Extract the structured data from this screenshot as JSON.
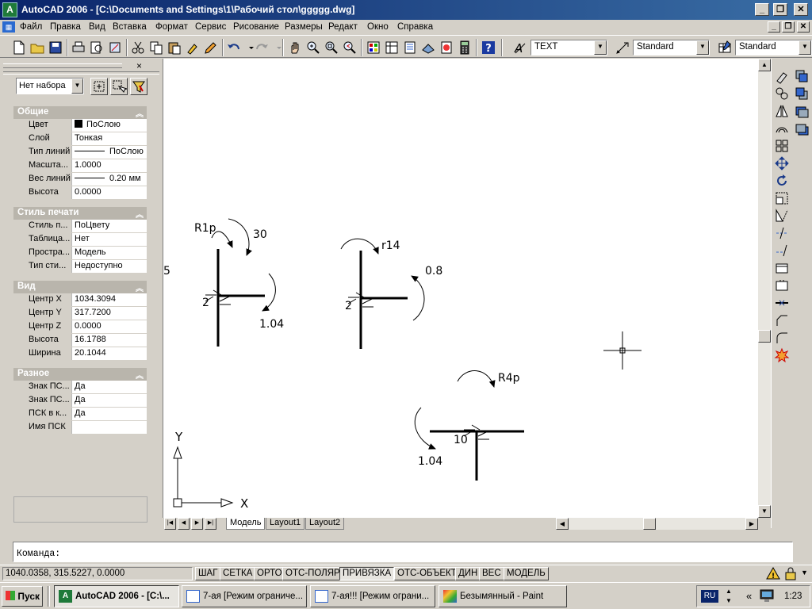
{
  "window": {
    "icon_text": "A",
    "title": "AutoCAD 2006 - [C:\\Documents and Settings\\1\\Рабочий стол\\ggggg.dwg]"
  },
  "menu": {
    "items": [
      "Файл",
      "Правка",
      "Вид",
      "Вставка",
      "Формат",
      "Сервис",
      "Рисование",
      "Размеры",
      "Редакт",
      "Окно",
      "Справка"
    ]
  },
  "toolbar": {
    "text_style": "TEXT",
    "dim_style": "Standard",
    "table_style": "Standard"
  },
  "palette": {
    "close_icon": "×",
    "selection": "Нет набора",
    "sections": [
      {
        "title": "Общие",
        "rows": [
          {
            "label": "Цвет",
            "value": "ПоСлою"
          },
          {
            "label": "Слой",
            "value": "Тонкая"
          },
          {
            "label": "Тип линий",
            "value": "ПоСлою"
          },
          {
            "label": "Масшта...",
            "value": "1.0000"
          },
          {
            "label": "Вес линий",
            "value": "0.20 мм"
          },
          {
            "label": "Высота",
            "value": "0.0000"
          }
        ]
      },
      {
        "title": "Стиль печати",
        "rows": [
          {
            "label": "Стиль п...",
            "value": "ПоЦвету"
          },
          {
            "label": "Таблица...",
            "value": "Нет"
          },
          {
            "label": "Простра...",
            "value": "Модель"
          },
          {
            "label": "Тип сти...",
            "value": "Недоступно"
          }
        ]
      },
      {
        "title": "Вид",
        "rows": [
          {
            "label": "Центр X",
            "value": "1034.3094"
          },
          {
            "label": "Центр Y",
            "value": "317.7200"
          },
          {
            "label": "Центр Z",
            "value": "0.0000"
          },
          {
            "label": "Высота",
            "value": "16.1788"
          },
          {
            "label": "Ширина",
            "value": "20.1044"
          }
        ]
      },
      {
        "title": "Разное",
        "rows": [
          {
            "label": "Знак ПС...",
            "value": "Да"
          },
          {
            "label": "Знак ПС...",
            "value": "Да"
          },
          {
            "label": "ПСК в к...",
            "value": "Да"
          },
          {
            "label": "Имя ПСК",
            "value": ""
          }
        ]
      }
    ]
  },
  "drawing": {
    "left_edge_label": "5",
    "fig1": {
      "r_label": "R1p",
      "angle_label": "30",
      "right_label": "1.04",
      "weld_label": "2"
    },
    "fig2": {
      "r_label": "r14",
      "right_label": "0.8",
      "weld_label": "2"
    },
    "fig3": {
      "r_label": "R4p",
      "left_label": "1.04",
      "weld_label": "10"
    },
    "ucs": {
      "x_label": "X",
      "y_label": "Y"
    }
  },
  "layout_tabs": [
    "Модель",
    "Layout1",
    "Layout2"
  ],
  "command": {
    "prompt": "Команда:"
  },
  "status": {
    "coords": "1040.0358, 315.5227, 0.0000",
    "toggles": [
      {
        "label": "ШАГ",
        "on": false
      },
      {
        "label": "СЕТКА",
        "on": false
      },
      {
        "label": "ОРТО",
        "on": false
      },
      {
        "label": "ОТС-ПОЛЯР",
        "on": false
      },
      {
        "label": "ПРИВЯЗКА",
        "on": true
      },
      {
        "label": "ОТС-ОБЪЕКТ",
        "on": false
      },
      {
        "label": "ДИН",
        "on": false
      },
      {
        "label": "ВЕС",
        "on": false
      },
      {
        "label": "МОДЕЛЬ",
        "on": false
      }
    ]
  },
  "taskbar": {
    "start": "Пуск",
    "tasks": [
      "AutoCAD 2006 - [C:\\...",
      "7-ая [Режим ограниче...",
      "7-ая!!! [Режим ограни...",
      "Безымянный - Paint"
    ],
    "lang": "RU",
    "chevron": "«",
    "clock": "1:23"
  }
}
